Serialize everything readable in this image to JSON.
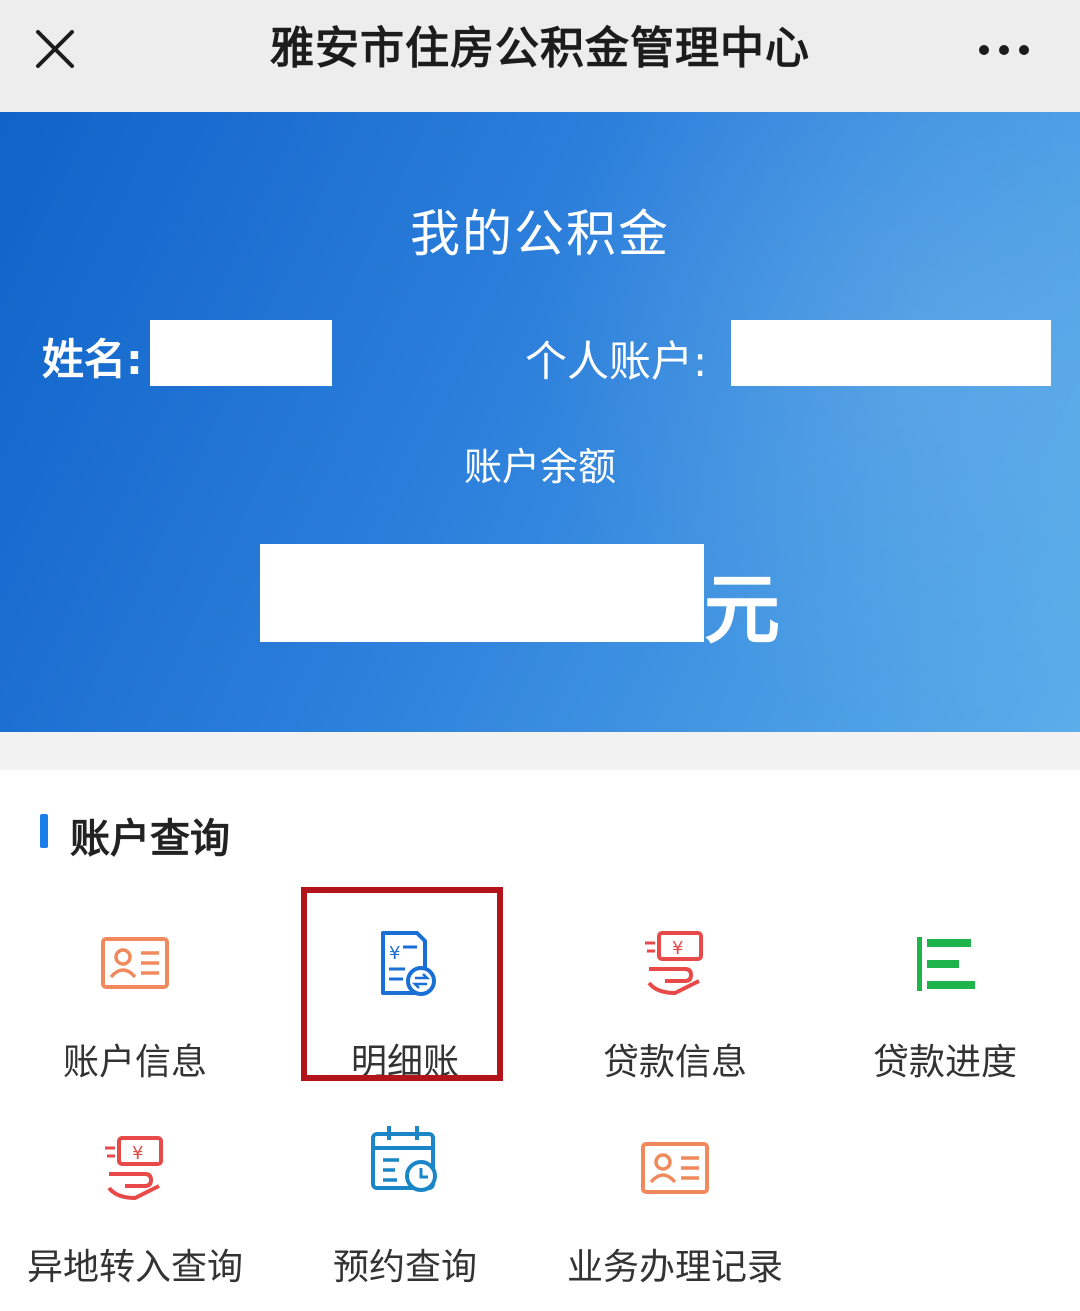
{
  "navbar": {
    "title": "雅安市住房公积金管理中心",
    "close_icon": "close-icon",
    "more_icon": "more-horizontal-icon"
  },
  "banner": {
    "title": "我的公积金",
    "name_label": "姓名:",
    "account_label": "个人账户:",
    "balance_label": "账户余额",
    "balance_unit": "元"
  },
  "section": {
    "title": "账户查询"
  },
  "menu": [
    {
      "label": "账户信息",
      "icon": "id-card-icon",
      "color": "#f08a5d"
    },
    {
      "label": "明细账",
      "icon": "ledger-icon",
      "color": "#1a6fd6"
    },
    {
      "label": "贷款信息",
      "icon": "loan-hand-icon",
      "color": "#e84a4a"
    },
    {
      "label": "贷款进度",
      "icon": "progress-bars-icon",
      "color": "#1fb34c"
    },
    {
      "label": "异地转入查询",
      "icon": "transfer-hand-icon",
      "color": "#e84a4a"
    },
    {
      "label": "预约查询",
      "icon": "calendar-clock-icon",
      "color": "#1a86c8"
    },
    {
      "label": "业务办理记录",
      "icon": "record-card-icon",
      "color": "#f08a5d"
    }
  ],
  "colors": {
    "banner_start": "#0f63c9",
    "banner_end": "#5aaeea",
    "accent": "#1a7ee8",
    "highlight": "#b3141b"
  }
}
